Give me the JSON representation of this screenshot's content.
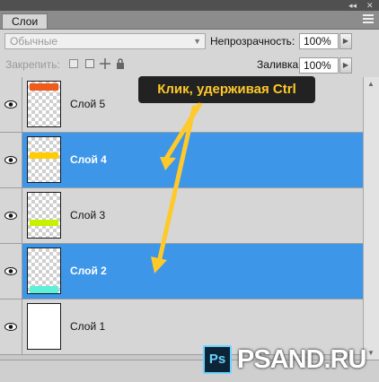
{
  "panel": {
    "tab_label": "Слои",
    "collapse_glyph": "◂◂",
    "close_glyph": "✕",
    "menu_icon": "panel-menu-icon"
  },
  "options": {
    "blend_mode": "Обычные",
    "opacity_label": "Непрозрачность:",
    "opacity_value": "100%",
    "lock_label": "Закрепить:",
    "fill_label": "Заливка:",
    "fill_value": "100%",
    "lock_icons": [
      "lock-transparent-icon",
      "lock-image-icon",
      "lock-position-icon",
      "lock-all-icon"
    ]
  },
  "layers": [
    {
      "name": "Слой 5",
      "selected": false,
      "stripe_color": "#f25a1c",
      "stripe_position": "top"
    },
    {
      "name": "Слой 4",
      "selected": true,
      "stripe_color": "#ffcc00",
      "stripe_position": "upper-middle"
    },
    {
      "name": "Слой 3",
      "selected": false,
      "stripe_color": "#c6f200",
      "stripe_position": "middle"
    },
    {
      "name": "Слой 2",
      "selected": true,
      "stripe_color": "#5ef0d8",
      "stripe_position": "bottom"
    },
    {
      "name": "Слой 1",
      "selected": false,
      "stripe_color": "#ffffff",
      "stripe_position": "none"
    }
  ],
  "callout": {
    "text": "Клик, удерживая Ctrl",
    "bg_color": "#222222",
    "text_color": "#ffc92a"
  },
  "colors": {
    "selection": "#3d96e8",
    "panel_bg": "#d6d6d6"
  },
  "watermark": {
    "badge": "Ps",
    "site": "PSAND.RU"
  }
}
